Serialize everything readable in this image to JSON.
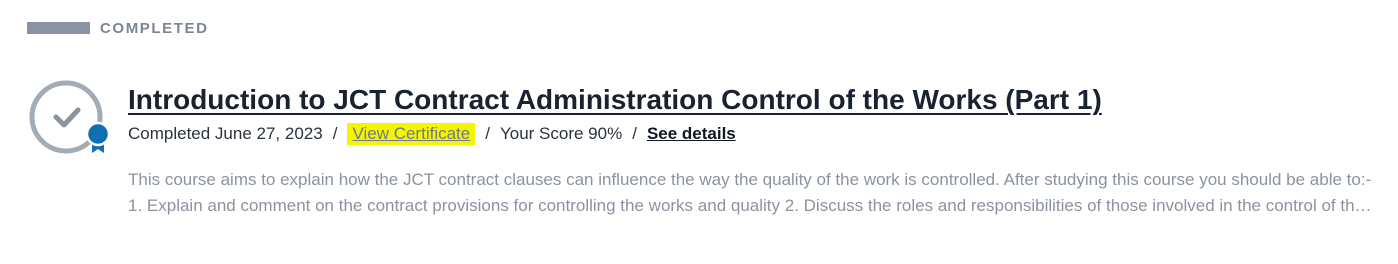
{
  "section": {
    "label": "COMPLETED"
  },
  "course": {
    "title": "Introduction to JCT Contract Administration Control of the Works (Part 1)",
    "completed_text": "Completed June 27, 2023",
    "certificate_label": "View Certificate",
    "score_text": "Your Score 90%",
    "details_label": "See details",
    "separator": "/",
    "description": "This course aims to explain how the JCT contract clauses can influence the way the quality of the work is controlled. After studying this course you should be able to:- 1. Explain and comment on the contract provisions for controlling the works and quality 2. Discuss the roles and responsibilities of those involved in the control of the works and quality"
  },
  "icons": {
    "status": "completed-check-icon",
    "badge": "certificate-ribbon-icon"
  },
  "colors": {
    "ring": "#a3abb7",
    "badge": "#0f6fb5",
    "highlight": "#f5f500",
    "heading_bar": "#8a93a3",
    "description": "#8b93a0"
  }
}
